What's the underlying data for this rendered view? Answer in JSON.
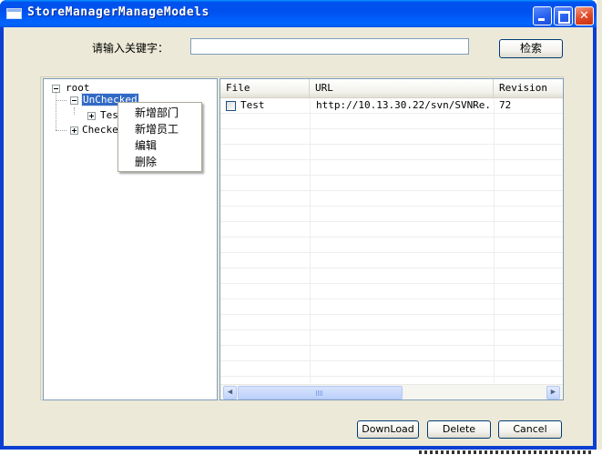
{
  "window": {
    "title": "StoreManagerManageModels",
    "min_glyph": "",
    "max_glyph": "",
    "close_glyph": "✕"
  },
  "search": {
    "label": "请输入关键字：",
    "value": "",
    "button_label": "检索"
  },
  "tree": {
    "root": {
      "label": "root",
      "expanded": true
    },
    "nodes": [
      {
        "label": "UnChecked",
        "expanded": true,
        "selected": true
      },
      {
        "label": "Tes",
        "expanded": false
      },
      {
        "label": "Checke",
        "expanded": false
      }
    ]
  },
  "context_menu": {
    "items": [
      "新增部门",
      "新增员工",
      "编辑",
      "删除"
    ]
  },
  "grid": {
    "columns": [
      "File",
      "URL",
      "Revision"
    ],
    "rows": [
      {
        "checked": false,
        "file": "Test",
        "url": "http://10.13.30.22/svn/SVNRe...",
        "revision": "72"
      }
    ],
    "scroll": {
      "left_arrow": "◀",
      "right_arrow": "▶"
    }
  },
  "buttons": {
    "download": "DownLoad",
    "delete": "Delete",
    "cancel": "Cancel"
  }
}
